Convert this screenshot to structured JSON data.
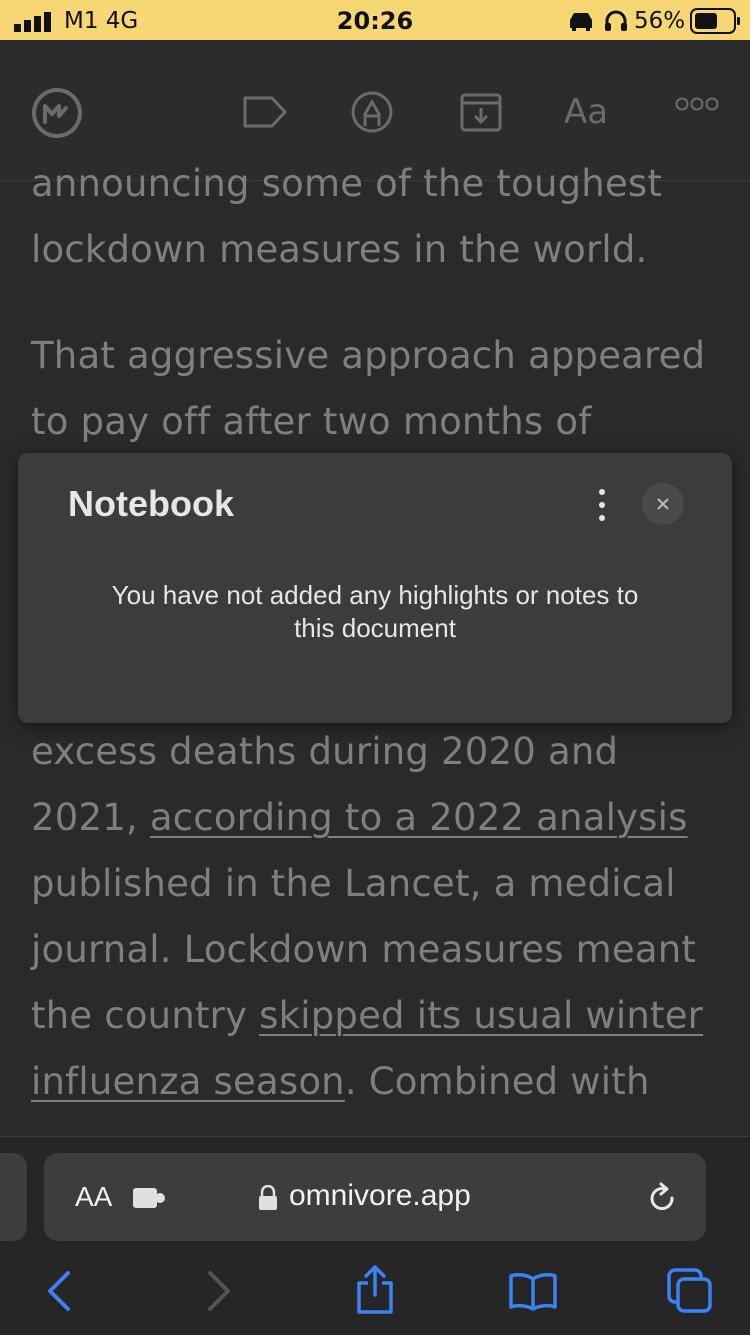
{
  "status_bar": {
    "carrier": "M1  4G",
    "time": "20:26",
    "battery": "56%"
  },
  "toolbar": {
    "icons": [
      "omnivore-logo-icon",
      "label-tag-icon",
      "highlighter-icon",
      "archive-icon",
      "font-settings-icon",
      "more-icon"
    ],
    "font_label": "Aa"
  },
  "article": {
    "lines_above": [
      "announcing some of the toughest",
      "lockdown measures in the world.",
      "That aggressive approach appeared",
      "to pay off after two months of"
    ],
    "line_excess": "excess deaths during 2020 and",
    "line_2021_prefix": "2021, ",
    "link_analysis": "according to a 2022 analysis",
    "line_published": "published in the Lancet, a medical",
    "line_journal": "journal. Lockdown measures meant",
    "line_country_prefix": "the country ",
    "link_skipped": "skipped its usual winter",
    "link_influenza": "influenza season",
    "line_combined_suffix": ". Combined with"
  },
  "notebook": {
    "title": "Notebook",
    "empty_message_line1": "You have not added any highlights or notes to",
    "empty_message_line2": "this document"
  },
  "safari": {
    "aa_label": "AA",
    "url": "omnivore.app"
  },
  "colors": {
    "status_bar_bg": "#f6d774",
    "accent_blue": "#3a82f7"
  }
}
